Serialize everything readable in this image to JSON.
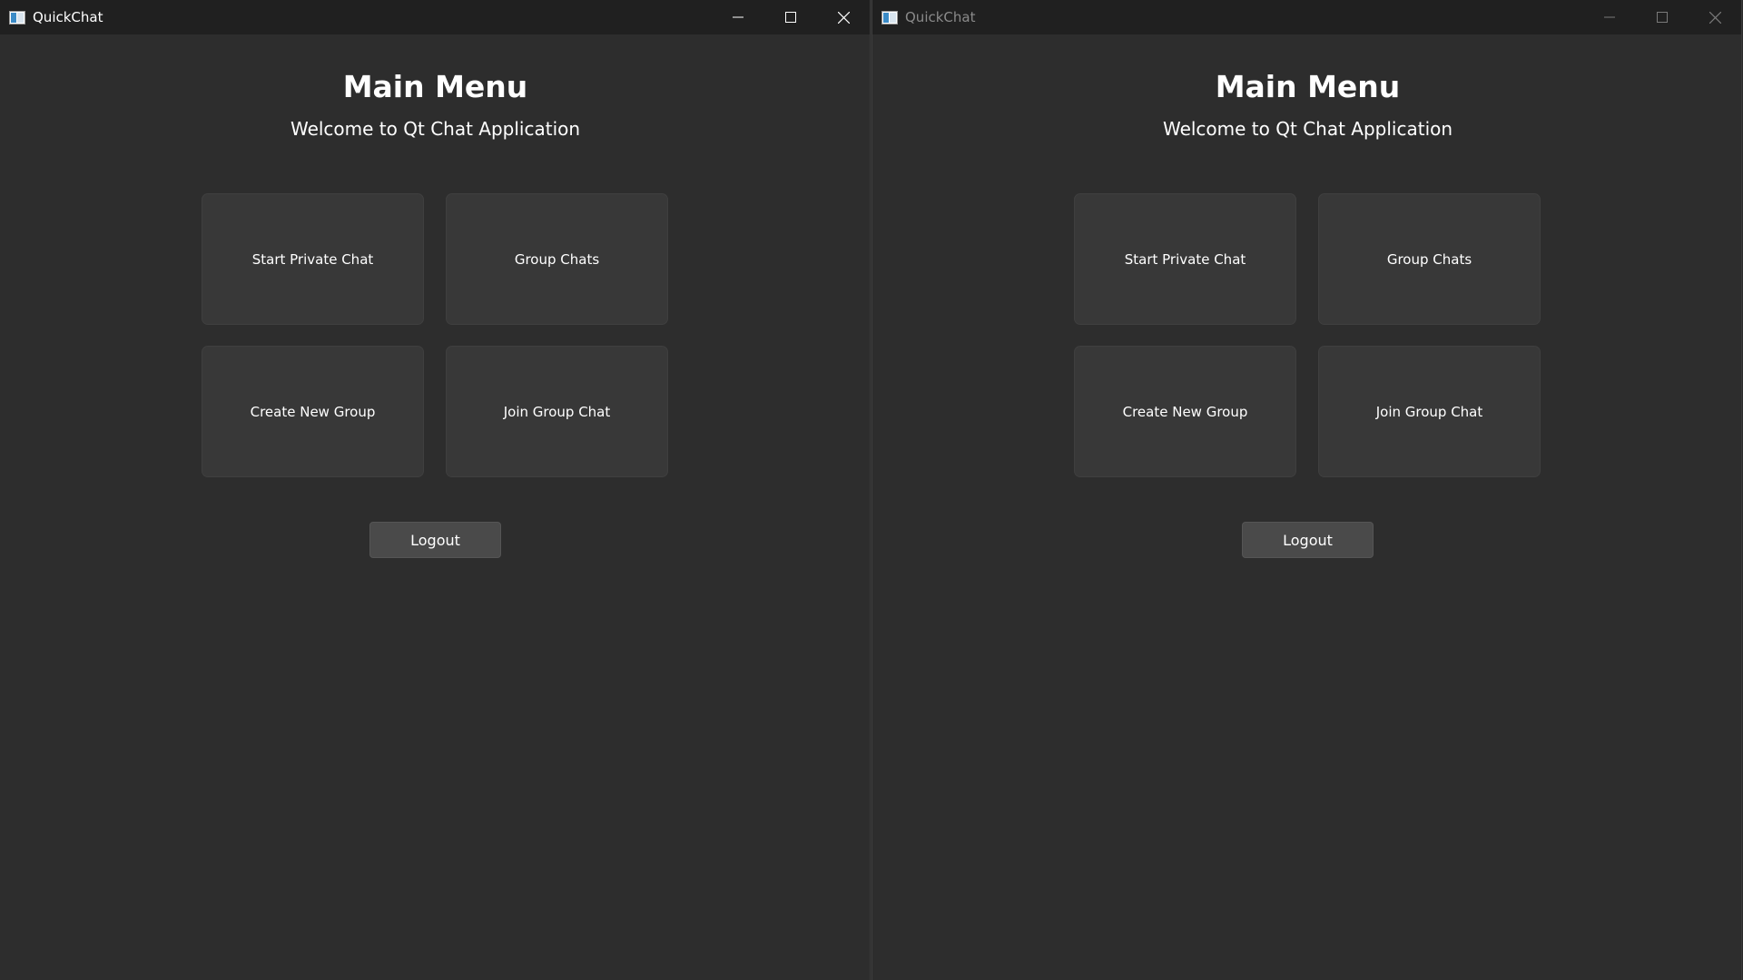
{
  "windows": [
    {
      "title": "QuickChat",
      "active": true,
      "heading": "Main Menu",
      "subtitle": "Welcome to Qt Chat Application",
      "buttons": {
        "start_private_chat": "Start Private Chat",
        "group_chats": "Group Chats",
        "create_new_group": "Create New Group",
        "join_group_chat": "Join Group Chat",
        "logout": "Logout"
      }
    },
    {
      "title": "QuickChat",
      "active": false,
      "heading": "Main Menu",
      "subtitle": "Welcome to Qt Chat Application",
      "buttons": {
        "start_private_chat": "Start Private Chat",
        "group_chats": "Group Chats",
        "create_new_group": "Create New Group",
        "join_group_chat": "Join Group Chat",
        "logout": "Logout"
      }
    }
  ],
  "icons": {
    "app": "app-window-icon",
    "minimize": "minimize-icon",
    "maximize": "maximize-icon",
    "close": "close-icon"
  },
  "colors": {
    "window_bg": "#2d2d2d",
    "titlebar_bg": "#202020",
    "tile_bg": "#383838",
    "button_bg": "#4a4a4a",
    "text": "#ffffff",
    "inactive_title": "#8a8a8a"
  }
}
